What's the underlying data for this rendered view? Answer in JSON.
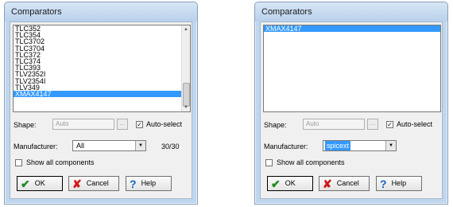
{
  "dialogs": [
    {
      "title": "Comparators",
      "list_items": [
        "TLC352",
        "TLC354",
        "TLC3702",
        "TLC3704",
        "TLC372",
        "TLC374",
        "TLC393",
        "TLV2352I",
        "TLV2354I",
        "TLV349",
        "XMAX4147"
      ],
      "selected_item": "XMAX4147",
      "shape_label": "Shape:",
      "shape_value": "Auto",
      "auto_select_label": "Auto-select",
      "auto_select_checked": true,
      "manufacturer_label": "Manufacturer:",
      "manufacturer_value": "All",
      "count": "30/30",
      "show_all_label": "Show all components",
      "show_all_checked": false,
      "ok_label": "OK",
      "cancel_label": "Cancel",
      "help_label": "Help"
    },
    {
      "title": "Comparators",
      "list_items": [
        "XMAX4147"
      ],
      "selected_item": "XMAX4147",
      "shape_label": "Shape:",
      "shape_value": "Auto",
      "auto_select_label": "Auto-select",
      "auto_select_checked": true,
      "manufacturer_label": "Manufacturer:",
      "manufacturer_value": "spicext",
      "show_all_label": "Show all components",
      "show_all_checked": false,
      "ok_label": "OK",
      "cancel_label": "Cancel",
      "help_label": "Help"
    }
  ],
  "colors": {
    "selection": "#3399ff",
    "frame": "#bfd7ee"
  },
  "icons": {
    "ok": "check-icon",
    "cancel": "x-icon",
    "help": "question-icon"
  }
}
